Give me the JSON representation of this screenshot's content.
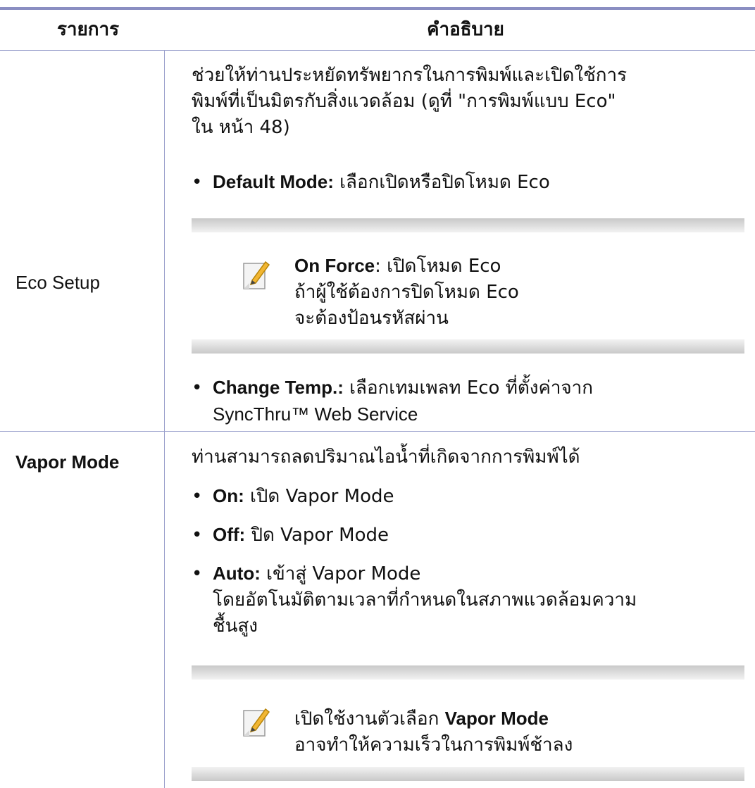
{
  "header": {
    "item": "รายการ",
    "description": "คำอธิบาย"
  },
  "rows": [
    {
      "item": "Eco Setup",
      "intro_lines": [
        "ช่วยให้ท่านประหยัดทรัพยากรในการพิมพ์และเปิดใช้การ",
        "พิมพ์ที่เป็นมิตรกับสิ่งแวดล้อม (ดูที่ \"การพิมพ์แบบ Eco\"",
        "ใน หน้า 48)"
      ],
      "bullet1": {
        "label": "Default Mode:",
        "text": " เลือกเปิดหรือปิดโหมด Eco"
      },
      "note": {
        "icon": "note-pencil-icon",
        "label": "On Force",
        "line1": ": เปิดโหมด Eco",
        "line2": "ถ้าผู้ใช้ต้องการปิดโหมด Eco",
        "line3": "จะต้องป้อนรหัสผ่าน"
      },
      "bullet2": {
        "label": "Change Temp.:",
        "line1": " เลือกเทมเพลท Eco ที่ตั้งค่าจาก",
        "line2": "SyncThru™ Web Service"
      }
    },
    {
      "item": "Vapor Mode",
      "intro": "ท่านสามารถลดปริมาณไอน้ำที่เกิดจากการพิมพ์ได้",
      "bullets": [
        {
          "label": "On:",
          "text": " เปิด Vapor Mode"
        },
        {
          "label": "Off:",
          "text": " ปิด Vapor Mode"
        }
      ],
      "auto": {
        "label": "Auto:",
        "line1": " เข้าสู่ Vapor Mode",
        "line2": "โดยอัตโนมัติตามเวลาที่กำหนดในสภาพแวดล้อมความ",
        "line3": "ชื้นสูง"
      },
      "note": {
        "icon": "note-pencil-icon",
        "pre": "เปิดใช้งานตัวเลือก ",
        "label": "Vapor Mode",
        "line2": "อาจทำให้ความเร็วในการพิมพ์ช้าลง"
      }
    }
  ]
}
